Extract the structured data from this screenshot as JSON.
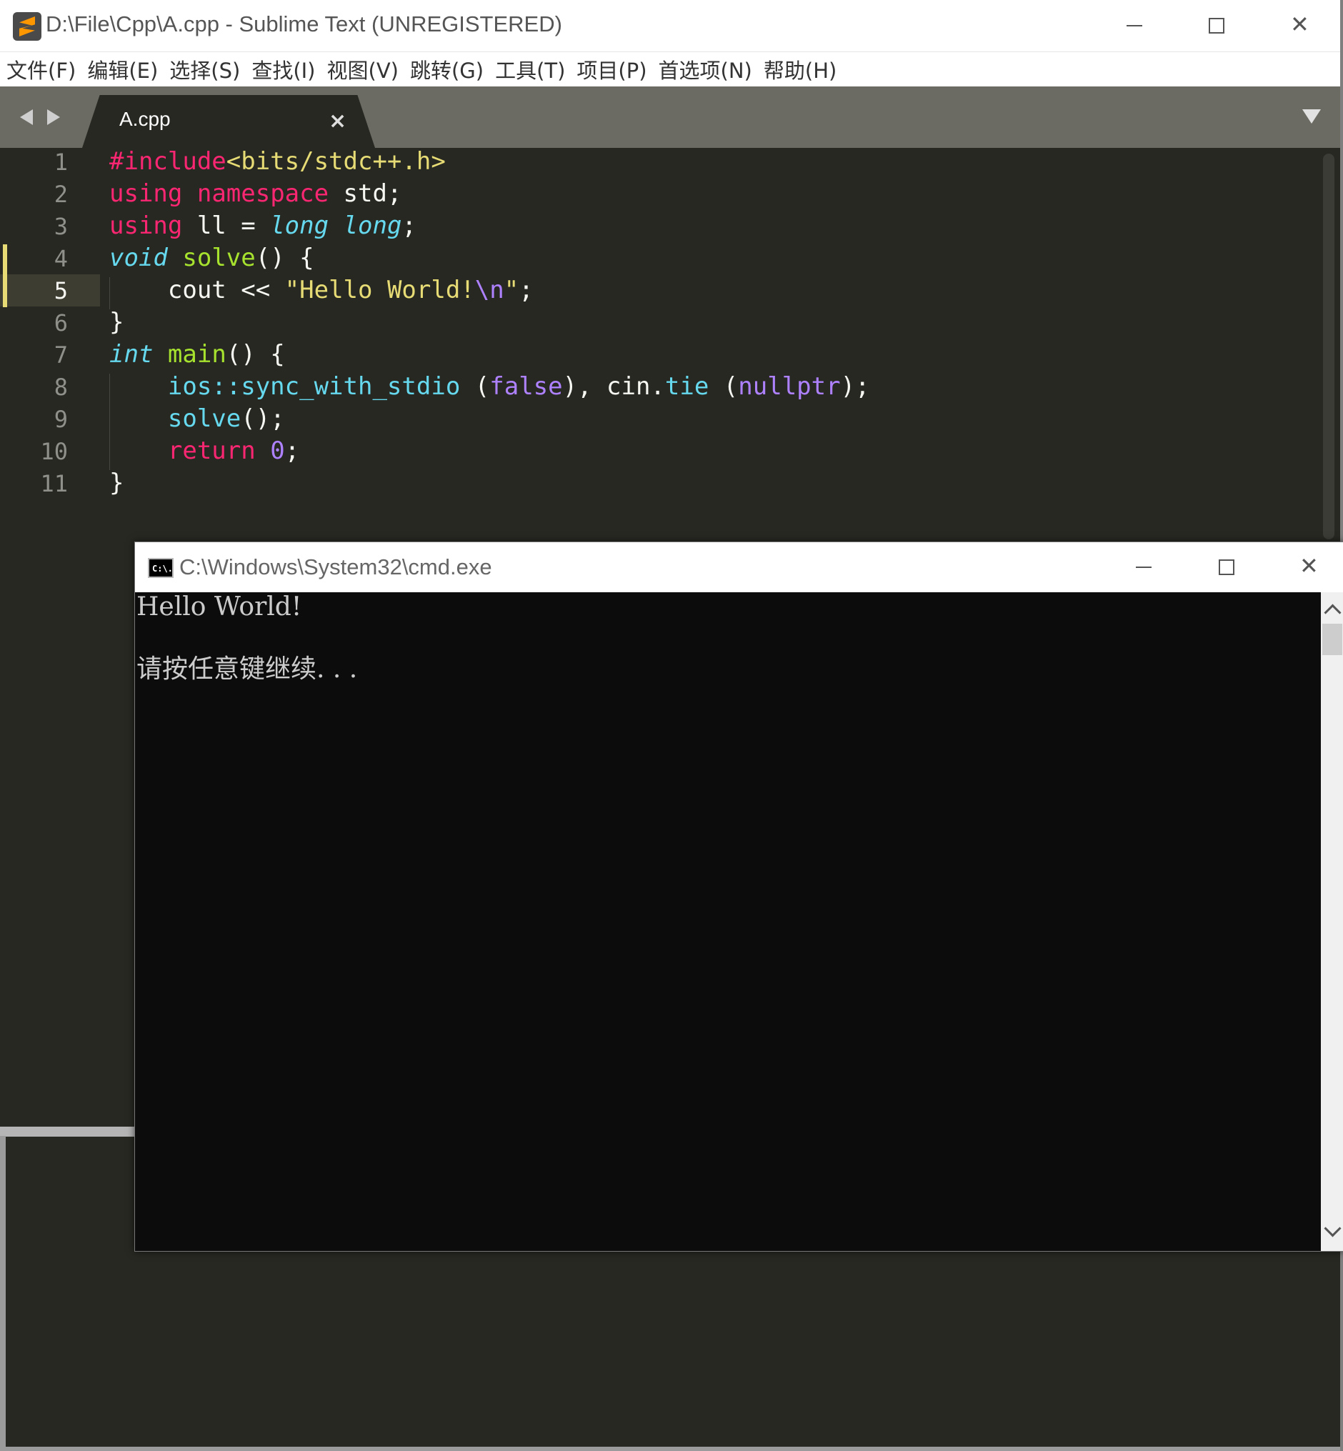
{
  "sublime": {
    "title": "D:\\File\\Cpp\\A.cpp - Sublime Text (UNREGISTERED)",
    "menu": [
      "文件(F)",
      "编辑(E)",
      "选择(S)",
      "查找(I)",
      "视图(V)",
      "跳转(G)",
      "工具(T)",
      "项目(P)",
      "首选项(N)",
      "帮助(H)"
    ],
    "tab": {
      "label": "A.cpp",
      "close": "×"
    },
    "line_numbers": [
      "1",
      "2",
      "3",
      "4",
      "5",
      "6",
      "7",
      "8",
      "9",
      "10",
      "11"
    ],
    "code": {
      "l1": {
        "directive": "#include",
        "header": "<bits/stdc++.h>"
      },
      "l2": {
        "using": "using",
        "namespace": "namespace",
        "rest": " std;"
      },
      "l3": {
        "using": "using",
        "mid": " ll = ",
        "t1": "long",
        "t2": "long",
        "end": ";"
      },
      "l4": {
        "void": "void",
        "name": "solve",
        "rest": "() {"
      },
      "l5": {
        "indent": "    ",
        "pre": "cout << ",
        "str": "\"Hello World!",
        "esc": "\\n",
        "strend": "\"",
        "end": ";"
      },
      "l6": {
        "text": "}"
      },
      "l7": {
        "int": "int",
        "name": "main",
        "rest": "() {"
      },
      "l8": {
        "indent": "    ",
        "fn1": "ios::sync_with_stdio",
        "p1": " (",
        "c1": "false",
        "mid": "), cin.",
        "fn2": "tie",
        "p2": " (",
        "c2": "nullptr",
        "end": ");"
      },
      "l9": {
        "indent": "    ",
        "fn": "solve",
        "end": "();"
      },
      "l10": {
        "indent": "    ",
        "ret": "return",
        "sp": " ",
        "num": "0",
        "end": ";"
      },
      "l11": {
        "text": "}"
      }
    }
  },
  "cmd": {
    "title": "C:\\Windows\\System32\\cmd.exe",
    "icon_text": "C:\\.",
    "output": [
      "Hello World!",
      "请按任意键继续. . ."
    ]
  },
  "window_controls": {
    "minimize": "—",
    "maximize": "☐",
    "close": "✕"
  }
}
